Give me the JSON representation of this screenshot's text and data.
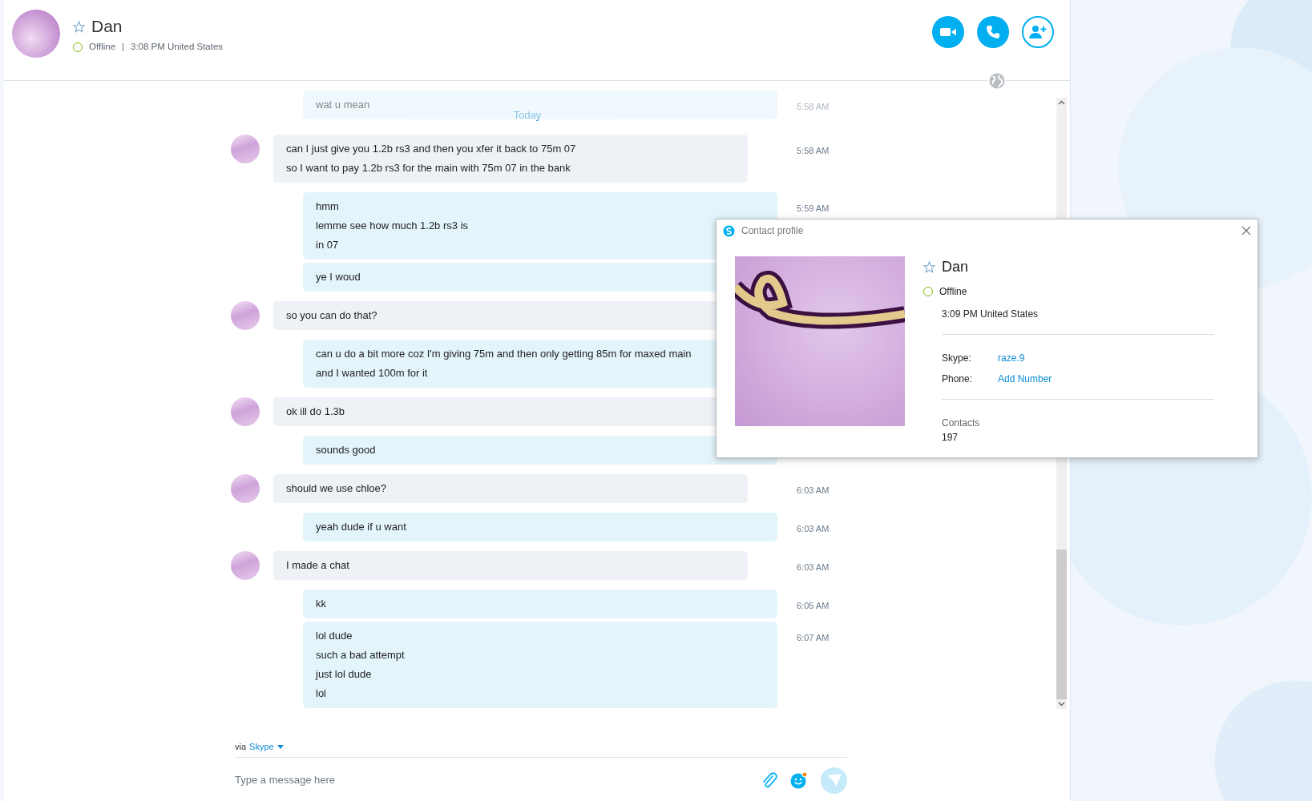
{
  "contact": {
    "name": "Dan",
    "favorite": false,
    "status": "Offline",
    "separator": "|",
    "local_time": "3:08 PM United States"
  },
  "header_buttons": [
    {
      "kind": "video"
    },
    {
      "kind": "call"
    },
    {
      "kind": "add_contact"
    }
  ],
  "conversation": {
    "faded_message": {
      "text": "wat u mean",
      "time": "5:58 AM"
    },
    "date_divider": "Today",
    "messages": [
      {
        "kind": "incoming",
        "lines": [
          "can I just give you 1.2b rs3 and then you xfer it back to 75m 07",
          "so I want to pay 1.2b rs3 for the main with 75m 07 in the bank"
        ],
        "time": "5:58 AM"
      },
      {
        "kind": "outgoing",
        "lines": [
          "hmm",
          "lemme see how much 1.2b rs3 is",
          "in 07"
        ],
        "time": "5:59 AM"
      },
      {
        "kind": "outgoing",
        "lines": [
          "ye I woud"
        ]
      },
      {
        "kind": "incoming",
        "lines": [
          "so you can do that?"
        ]
      },
      {
        "kind": "outgoing",
        "lines": [
          "can u do a bit more coz I'm giving 75m and then only getting 85m for maxed main",
          "and I wanted 100m for it"
        ]
      },
      {
        "kind": "incoming",
        "lines": [
          "ok ill do 1.3b"
        ]
      },
      {
        "kind": "outgoing",
        "lines": [
          "sounds good"
        ]
      },
      {
        "kind": "incoming",
        "lines": [
          "should we use chloe?"
        ],
        "time": "6:03 AM"
      },
      {
        "kind": "outgoing",
        "lines": [
          "yeah dude if u want"
        ],
        "time": "6:03 AM"
      },
      {
        "kind": "incoming",
        "lines": [
          "I made a chat"
        ],
        "time": "6:03 AM"
      },
      {
        "kind": "outgoing",
        "lines": [
          "kk"
        ],
        "time": "6:05 AM"
      },
      {
        "kind": "outgoing",
        "lines": [
          "lol dude",
          "such a bad attempt",
          "just lol dude",
          "lol"
        ],
        "time": "6:07 AM"
      }
    ]
  },
  "compose": {
    "via_label": "via",
    "service": "Skype",
    "placeholder": "Type a message here"
  },
  "profile_popup": {
    "title": "Contact profile",
    "name": "Dan",
    "favorite": false,
    "status": "Offline",
    "local_time": "3:09 PM United States",
    "fields": [
      {
        "label": "Skype:",
        "value": "raze.9"
      },
      {
        "label": "Phone:",
        "value": "Add Number"
      }
    ],
    "contacts_label": "Contacts",
    "contacts_count": "197"
  }
}
